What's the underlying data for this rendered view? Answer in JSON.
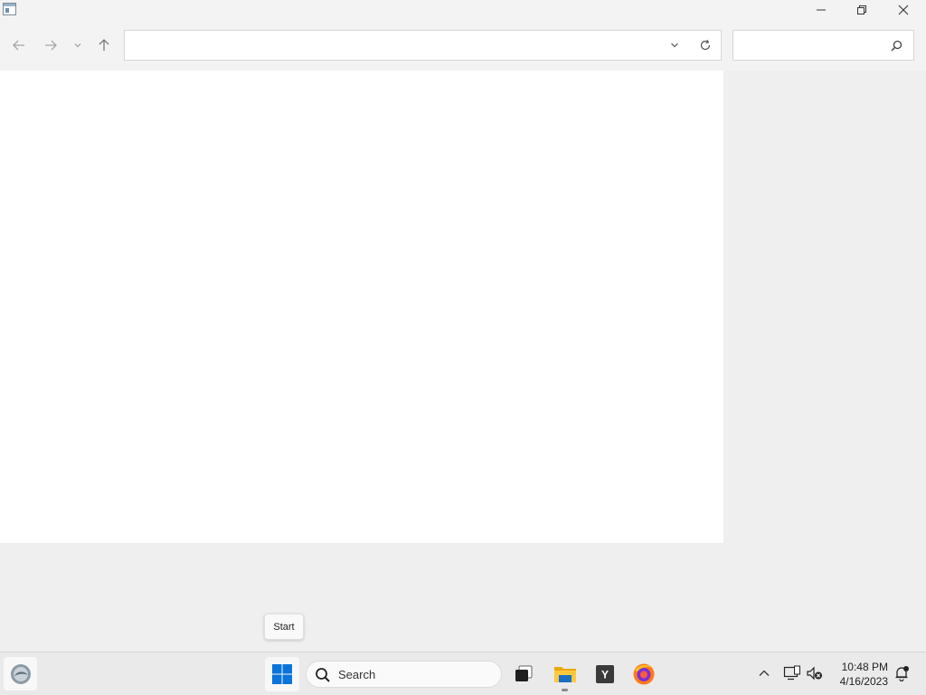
{
  "window": {
    "title": "",
    "controls": {
      "minimize": "minimize-icon",
      "restore": "restore-icon",
      "close": "close-icon"
    }
  },
  "navigation": {
    "back": "arrow-left-icon",
    "forward": "arrow-right-icon",
    "recent": "chevron-down-icon",
    "up": "arrow-up-icon"
  },
  "address_bar": {
    "value": "",
    "placeholder": ""
  },
  "search_box": {
    "value": "",
    "placeholder": ""
  },
  "tooltip": {
    "text": "Start"
  },
  "taskbar": {
    "search_label": "Search",
    "apps": [
      "task-view-icon",
      "file-explorer-icon",
      "yandex-icon",
      "firefox-icon"
    ],
    "yandex_letter": "Y",
    "clock": {
      "time": "10:48 PM",
      "date": "4/16/2023"
    }
  },
  "colors": {
    "window_bg": "#f3f3f3",
    "content_bg": "#ffffff",
    "taskbar_bg": "#eaeaea",
    "start_blue": "#0a74da"
  }
}
